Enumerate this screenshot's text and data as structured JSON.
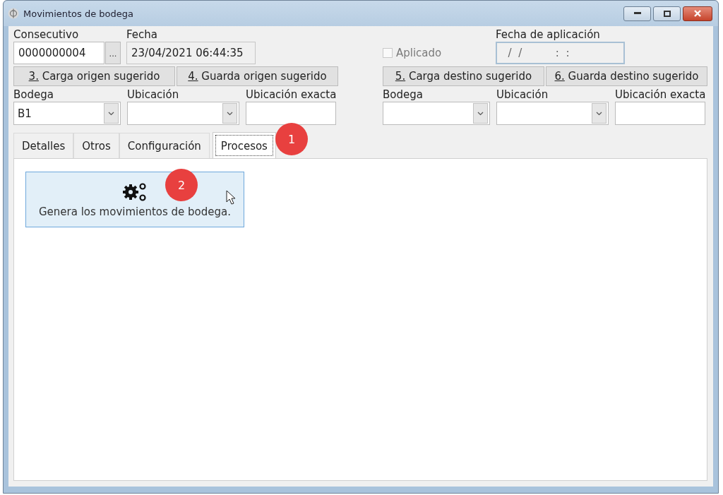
{
  "window": {
    "title": "Movimientos de bodega"
  },
  "header": {
    "consecutivo": {
      "label": "Consecutivo",
      "value": "0000000004",
      "button": "..."
    },
    "fecha": {
      "label": "Fecha",
      "value": "23/04/2021 06:44:35"
    },
    "aplicado": {
      "label": "Aplicado",
      "checked": false,
      "disabled": true
    },
    "fecha_aplicacion": {
      "label": "Fecha de aplicación",
      "value": "  /  /          :  :"
    }
  },
  "origin": {
    "buttons": [
      "3. Carga origen sugerido",
      "4. Guarda origen sugerido"
    ],
    "fields": [
      {
        "kind": "combo",
        "label": "Bodega",
        "value": "B1"
      },
      {
        "kind": "combo",
        "label": "Ubicación"
      },
      {
        "kind": "text",
        "label": "Ubicación exacta"
      }
    ]
  },
  "destination": {
    "buttons": [
      "5. Carga destino sugerido",
      "6. Guarda destino sugerido"
    ],
    "fields": [
      {
        "kind": "combo",
        "label": "Bodega"
      },
      {
        "kind": "combo",
        "label": "Ubicación"
      },
      {
        "kind": "text",
        "label": "Ubicación exacta"
      }
    ]
  },
  "tabs": [
    {
      "label": "Detalles",
      "selected": false
    },
    {
      "label": "Otros",
      "selected": false
    },
    {
      "label": "Configuración",
      "selected": false
    },
    {
      "label": "Procesos",
      "selected": true
    }
  ],
  "processes": [
    {
      "label": "Genera los movimientos de bodega."
    }
  ],
  "annotations": [
    "1",
    "2"
  ]
}
